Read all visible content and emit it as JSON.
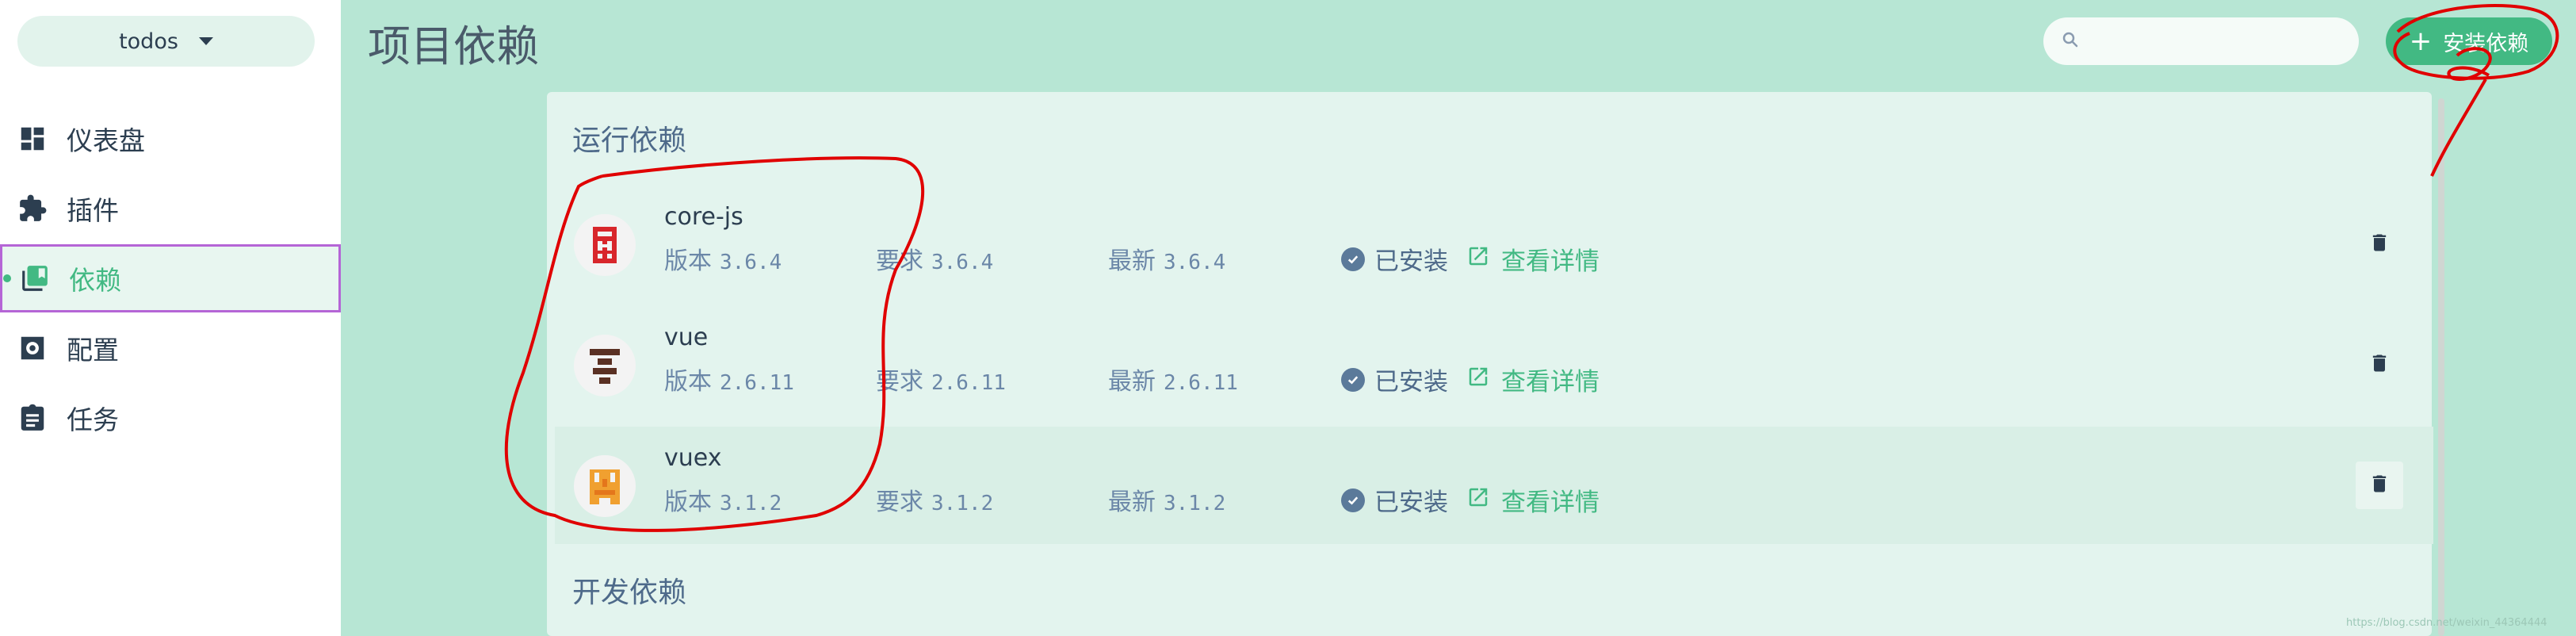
{
  "sidebar": {
    "project_name": "todos",
    "items": [
      {
        "label": "仪表盘",
        "icon": "dashboard-icon"
      },
      {
        "label": "插件",
        "icon": "puzzle-icon"
      },
      {
        "label": "依赖",
        "icon": "library-icon",
        "active": true
      },
      {
        "label": "配置",
        "icon": "settings-icon"
      },
      {
        "label": "任务",
        "icon": "clipboard-icon"
      }
    ]
  },
  "header": {
    "title": "项目依赖",
    "search_placeholder": "",
    "install_label": "安装依赖"
  },
  "sections": {
    "runtime": "运行依赖",
    "dev": "开发依赖"
  },
  "dependencies": [
    {
      "name": "core-js",
      "version_label": "版本",
      "version": "3.6.4",
      "required_label": "要求",
      "required": "3.6.4",
      "latest_label": "最新",
      "latest": "3.6.4",
      "status": "已安装",
      "details": "查看详情"
    },
    {
      "name": "vue",
      "version_label": "版本",
      "version": "2.6.11",
      "required_label": "要求",
      "required": "2.6.11",
      "latest_label": "最新",
      "latest": "2.6.11",
      "status": "已安装",
      "details": "查看详情"
    },
    {
      "name": "vuex",
      "version_label": "版本",
      "version": "3.1.2",
      "required_label": "要求",
      "required": "3.1.2",
      "latest_label": "最新",
      "latest": "3.1.2",
      "status": "已安装",
      "details": "查看详情"
    }
  ],
  "colors": {
    "accent": "#42b983",
    "background": "#b7e6d4",
    "annotation": "#e00000"
  },
  "watermark": "https://blog.csdn.net/weixin_44364444"
}
